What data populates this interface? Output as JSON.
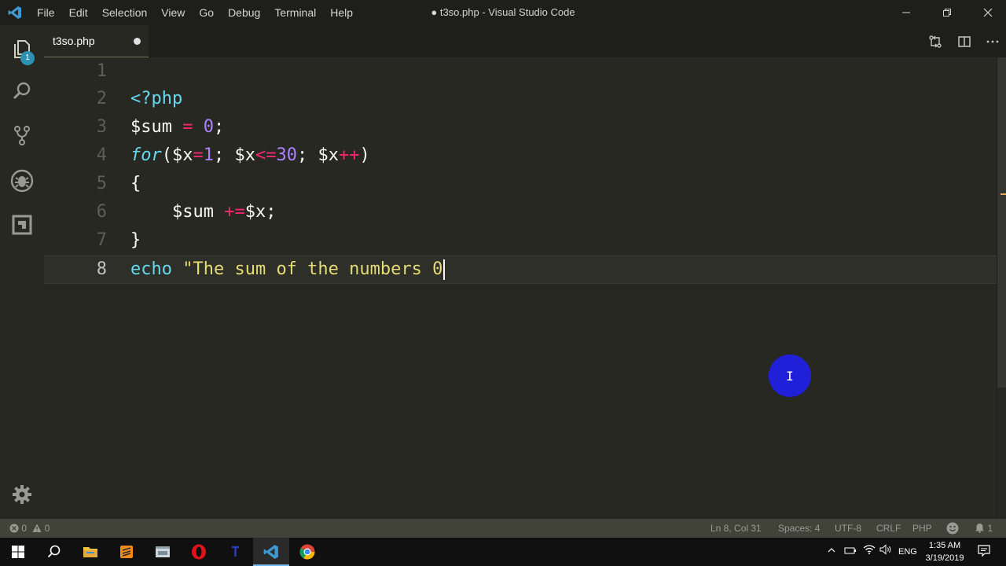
{
  "app": {
    "window_title": "● t3so.php - Visual Studio Code",
    "menu": [
      "File",
      "Edit",
      "Selection",
      "View",
      "Go",
      "Debug",
      "Terminal",
      "Help"
    ]
  },
  "activity": {
    "explorer_badge": "1"
  },
  "tab": {
    "label": "t3so.php",
    "dirty": true
  },
  "editor": {
    "line_numbers": [
      "1",
      "2",
      "3",
      "4",
      "5",
      "6",
      "7",
      "8"
    ],
    "current_line": 8
  },
  "status": {
    "errors": "0",
    "warnings": "0",
    "position": "Ln 8, Col 31",
    "indent": "Spaces: 4",
    "encoding": "UTF-8",
    "eol": "CRLF",
    "language": "PHP",
    "notifications": "1"
  },
  "taskbar": {
    "language": "ENG",
    "time": "1:35 AM",
    "date": "3/19/2019"
  },
  "colors": {
    "editor_bg": "#272822",
    "keyword": "#66d9ef",
    "operator": "#f92672",
    "number": "#ae81ff",
    "string": "#e6db74",
    "pointer_highlight": "#1f20d8"
  },
  "icons": [
    "vscode-logo-icon",
    "files-icon",
    "search-icon",
    "source-control-icon",
    "debug-icon",
    "extensions-icon",
    "gear-icon",
    "compare-changes-icon",
    "split-editor-icon",
    "more-icon"
  ]
}
